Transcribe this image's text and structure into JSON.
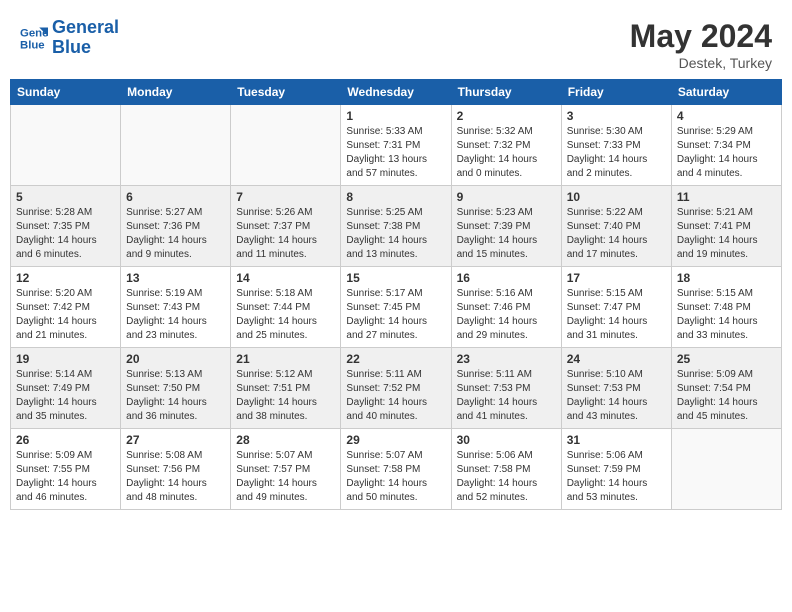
{
  "header": {
    "logo_line1": "General",
    "logo_line2": "Blue",
    "month_year": "May 2024",
    "location": "Destek, Turkey"
  },
  "weekdays": [
    "Sunday",
    "Monday",
    "Tuesday",
    "Wednesday",
    "Thursday",
    "Friday",
    "Saturday"
  ],
  "weeks": [
    [
      {
        "day": "",
        "empty": true
      },
      {
        "day": "",
        "empty": true
      },
      {
        "day": "",
        "empty": true
      },
      {
        "day": "1",
        "sunrise": "Sunrise: 5:33 AM",
        "sunset": "Sunset: 7:31 PM",
        "daylight": "Daylight: 13 hours and 57 minutes."
      },
      {
        "day": "2",
        "sunrise": "Sunrise: 5:32 AM",
        "sunset": "Sunset: 7:32 PM",
        "daylight": "Daylight: 14 hours and 0 minutes."
      },
      {
        "day": "3",
        "sunrise": "Sunrise: 5:30 AM",
        "sunset": "Sunset: 7:33 PM",
        "daylight": "Daylight: 14 hours and 2 minutes."
      },
      {
        "day": "4",
        "sunrise": "Sunrise: 5:29 AM",
        "sunset": "Sunset: 7:34 PM",
        "daylight": "Daylight: 14 hours and 4 minutes."
      }
    ],
    [
      {
        "day": "5",
        "sunrise": "Sunrise: 5:28 AM",
        "sunset": "Sunset: 7:35 PM",
        "daylight": "Daylight: 14 hours and 6 minutes."
      },
      {
        "day": "6",
        "sunrise": "Sunrise: 5:27 AM",
        "sunset": "Sunset: 7:36 PM",
        "daylight": "Daylight: 14 hours and 9 minutes."
      },
      {
        "day": "7",
        "sunrise": "Sunrise: 5:26 AM",
        "sunset": "Sunset: 7:37 PM",
        "daylight": "Daylight: 14 hours and 11 minutes."
      },
      {
        "day": "8",
        "sunrise": "Sunrise: 5:25 AM",
        "sunset": "Sunset: 7:38 PM",
        "daylight": "Daylight: 14 hours and 13 minutes."
      },
      {
        "day": "9",
        "sunrise": "Sunrise: 5:23 AM",
        "sunset": "Sunset: 7:39 PM",
        "daylight": "Daylight: 14 hours and 15 minutes."
      },
      {
        "day": "10",
        "sunrise": "Sunrise: 5:22 AM",
        "sunset": "Sunset: 7:40 PM",
        "daylight": "Daylight: 14 hours and 17 minutes."
      },
      {
        "day": "11",
        "sunrise": "Sunrise: 5:21 AM",
        "sunset": "Sunset: 7:41 PM",
        "daylight": "Daylight: 14 hours and 19 minutes."
      }
    ],
    [
      {
        "day": "12",
        "sunrise": "Sunrise: 5:20 AM",
        "sunset": "Sunset: 7:42 PM",
        "daylight": "Daylight: 14 hours and 21 minutes."
      },
      {
        "day": "13",
        "sunrise": "Sunrise: 5:19 AM",
        "sunset": "Sunset: 7:43 PM",
        "daylight": "Daylight: 14 hours and 23 minutes."
      },
      {
        "day": "14",
        "sunrise": "Sunrise: 5:18 AM",
        "sunset": "Sunset: 7:44 PM",
        "daylight": "Daylight: 14 hours and 25 minutes."
      },
      {
        "day": "15",
        "sunrise": "Sunrise: 5:17 AM",
        "sunset": "Sunset: 7:45 PM",
        "daylight": "Daylight: 14 hours and 27 minutes."
      },
      {
        "day": "16",
        "sunrise": "Sunrise: 5:16 AM",
        "sunset": "Sunset: 7:46 PM",
        "daylight": "Daylight: 14 hours and 29 minutes."
      },
      {
        "day": "17",
        "sunrise": "Sunrise: 5:15 AM",
        "sunset": "Sunset: 7:47 PM",
        "daylight": "Daylight: 14 hours and 31 minutes."
      },
      {
        "day": "18",
        "sunrise": "Sunrise: 5:15 AM",
        "sunset": "Sunset: 7:48 PM",
        "daylight": "Daylight: 14 hours and 33 minutes."
      }
    ],
    [
      {
        "day": "19",
        "sunrise": "Sunrise: 5:14 AM",
        "sunset": "Sunset: 7:49 PM",
        "daylight": "Daylight: 14 hours and 35 minutes."
      },
      {
        "day": "20",
        "sunrise": "Sunrise: 5:13 AM",
        "sunset": "Sunset: 7:50 PM",
        "daylight": "Daylight: 14 hours and 36 minutes."
      },
      {
        "day": "21",
        "sunrise": "Sunrise: 5:12 AM",
        "sunset": "Sunset: 7:51 PM",
        "daylight": "Daylight: 14 hours and 38 minutes."
      },
      {
        "day": "22",
        "sunrise": "Sunrise: 5:11 AM",
        "sunset": "Sunset: 7:52 PM",
        "daylight": "Daylight: 14 hours and 40 minutes."
      },
      {
        "day": "23",
        "sunrise": "Sunrise: 5:11 AM",
        "sunset": "Sunset: 7:53 PM",
        "daylight": "Daylight: 14 hours and 41 minutes."
      },
      {
        "day": "24",
        "sunrise": "Sunrise: 5:10 AM",
        "sunset": "Sunset: 7:53 PM",
        "daylight": "Daylight: 14 hours and 43 minutes."
      },
      {
        "day": "25",
        "sunrise": "Sunrise: 5:09 AM",
        "sunset": "Sunset: 7:54 PM",
        "daylight": "Daylight: 14 hours and 45 minutes."
      }
    ],
    [
      {
        "day": "26",
        "sunrise": "Sunrise: 5:09 AM",
        "sunset": "Sunset: 7:55 PM",
        "daylight": "Daylight: 14 hours and 46 minutes."
      },
      {
        "day": "27",
        "sunrise": "Sunrise: 5:08 AM",
        "sunset": "Sunset: 7:56 PM",
        "daylight": "Daylight: 14 hours and 48 minutes."
      },
      {
        "day": "28",
        "sunrise": "Sunrise: 5:07 AM",
        "sunset": "Sunset: 7:57 PM",
        "daylight": "Daylight: 14 hours and 49 minutes."
      },
      {
        "day": "29",
        "sunrise": "Sunrise: 5:07 AM",
        "sunset": "Sunset: 7:58 PM",
        "daylight": "Daylight: 14 hours and 50 minutes."
      },
      {
        "day": "30",
        "sunrise": "Sunrise: 5:06 AM",
        "sunset": "Sunset: 7:58 PM",
        "daylight": "Daylight: 14 hours and 52 minutes."
      },
      {
        "day": "31",
        "sunrise": "Sunrise: 5:06 AM",
        "sunset": "Sunset: 7:59 PM",
        "daylight": "Daylight: 14 hours and 53 minutes."
      },
      {
        "day": "",
        "empty": true
      }
    ]
  ]
}
